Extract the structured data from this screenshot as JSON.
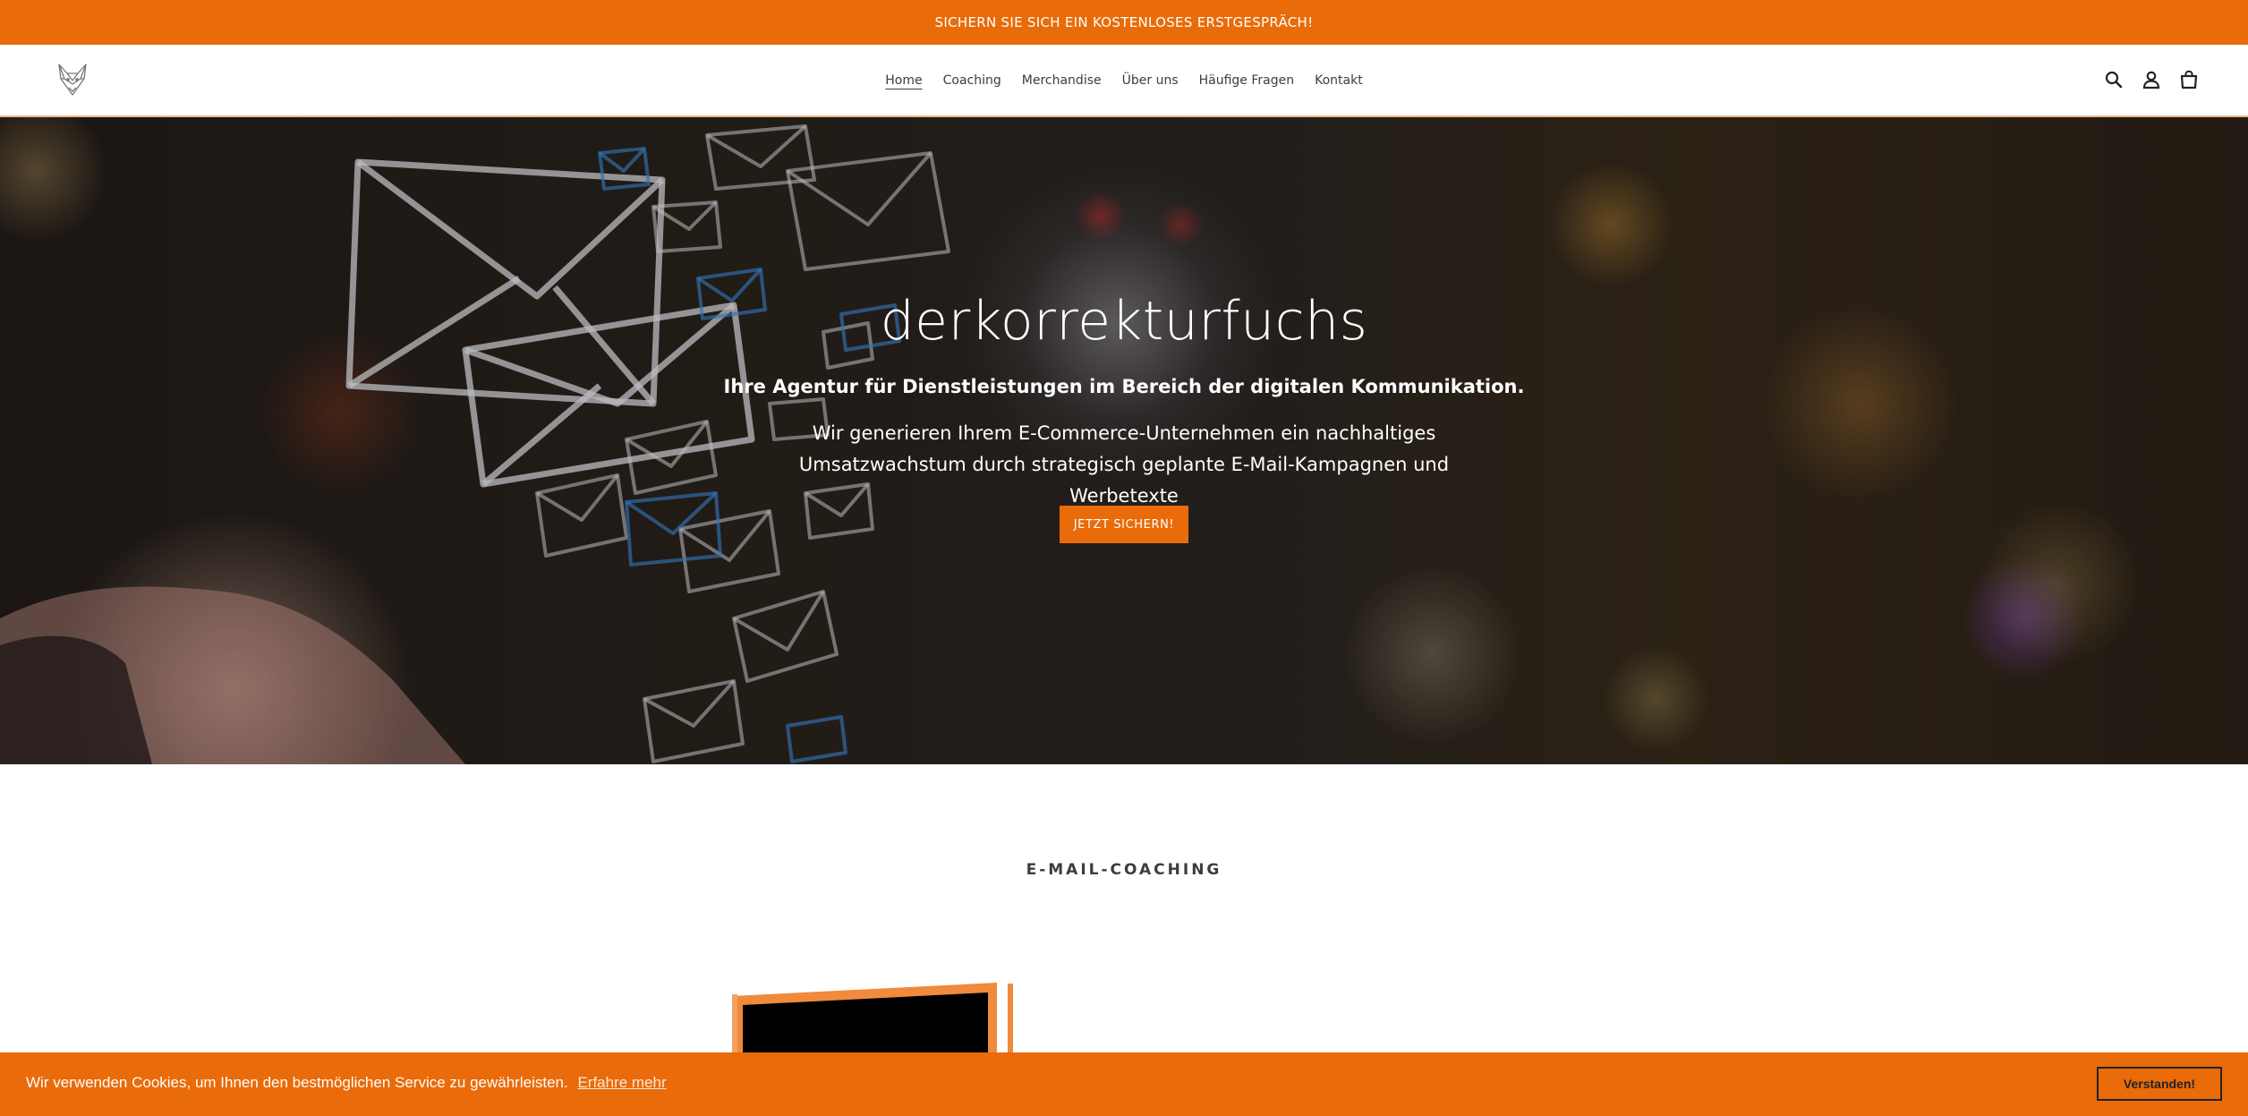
{
  "announcement": {
    "text": "SICHERN SIE SICH EIN KOSTENLOSES ERSTGESPRÄCH!"
  },
  "header": {
    "nav": [
      {
        "label": "Home",
        "active": true
      },
      {
        "label": "Coaching"
      },
      {
        "label": "Merchandise"
      },
      {
        "label": "Über uns"
      },
      {
        "label": "Häufige Fragen"
      },
      {
        "label": "Kontakt"
      }
    ],
    "icons": [
      "search-icon",
      "account-icon",
      "cart-icon"
    ],
    "logo_icon": "fox-logo-icon"
  },
  "hero": {
    "title": "derkorrekturfuchs",
    "subtitle": "Ihre Agentur für Dienstleistungen im Bereich der digitalen Kommunikation.",
    "text": "Wir generieren Ihrem E-Commerce-Unternehmen ein nachhaltiges Umsatzwachstum durch strategisch geplante E-Mail-Kampagnen und Werbetexte",
    "button_label": "JETZT SICHERN!"
  },
  "section": {
    "heading": "E-MAIL-COACHING"
  },
  "cookie": {
    "text": "Wir verwenden Cookies, um Ihnen den bestmöglichen Service zu gewährleisten.",
    "link_label": "Erfahre mehr",
    "button_label": "Verstanden!"
  },
  "colors": {
    "accent": "#E96B09",
    "header_border": "#E8B98C",
    "text_dark": "#3D3D3D",
    "white": "#FFFFFF"
  }
}
